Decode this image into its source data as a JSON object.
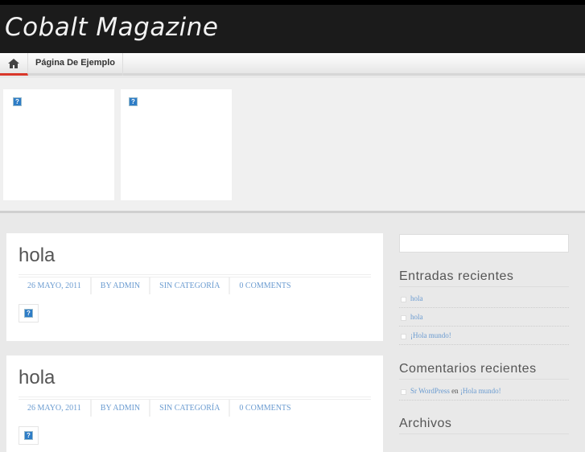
{
  "site": {
    "title": "Cobalt Magazine"
  },
  "nav": {
    "items": [
      {
        "label": "Página De Ejemplo"
      }
    ]
  },
  "posts": [
    {
      "title": "hola",
      "date": "26 MAYO, 2011",
      "author": "BY ADMIN",
      "category": "SIN CATEGORÍA",
      "comments": "0 COMMENTS"
    },
    {
      "title": "hola",
      "date": "26 MAYO, 2011",
      "author": "BY ADMIN",
      "category": "SIN CATEGORÍA",
      "comments": "0 COMMENTS"
    }
  ],
  "sidebar": {
    "recent_posts": {
      "title": "Entradas recientes",
      "items": [
        "hola",
        "hola",
        "¡Hola mundo!"
      ]
    },
    "recent_comments": {
      "title": "Comentarios recientes",
      "author": "Sr WordPress",
      "sep": "en",
      "post": "¡Hola mundo!"
    },
    "archives": {
      "title": "Archivos"
    }
  }
}
